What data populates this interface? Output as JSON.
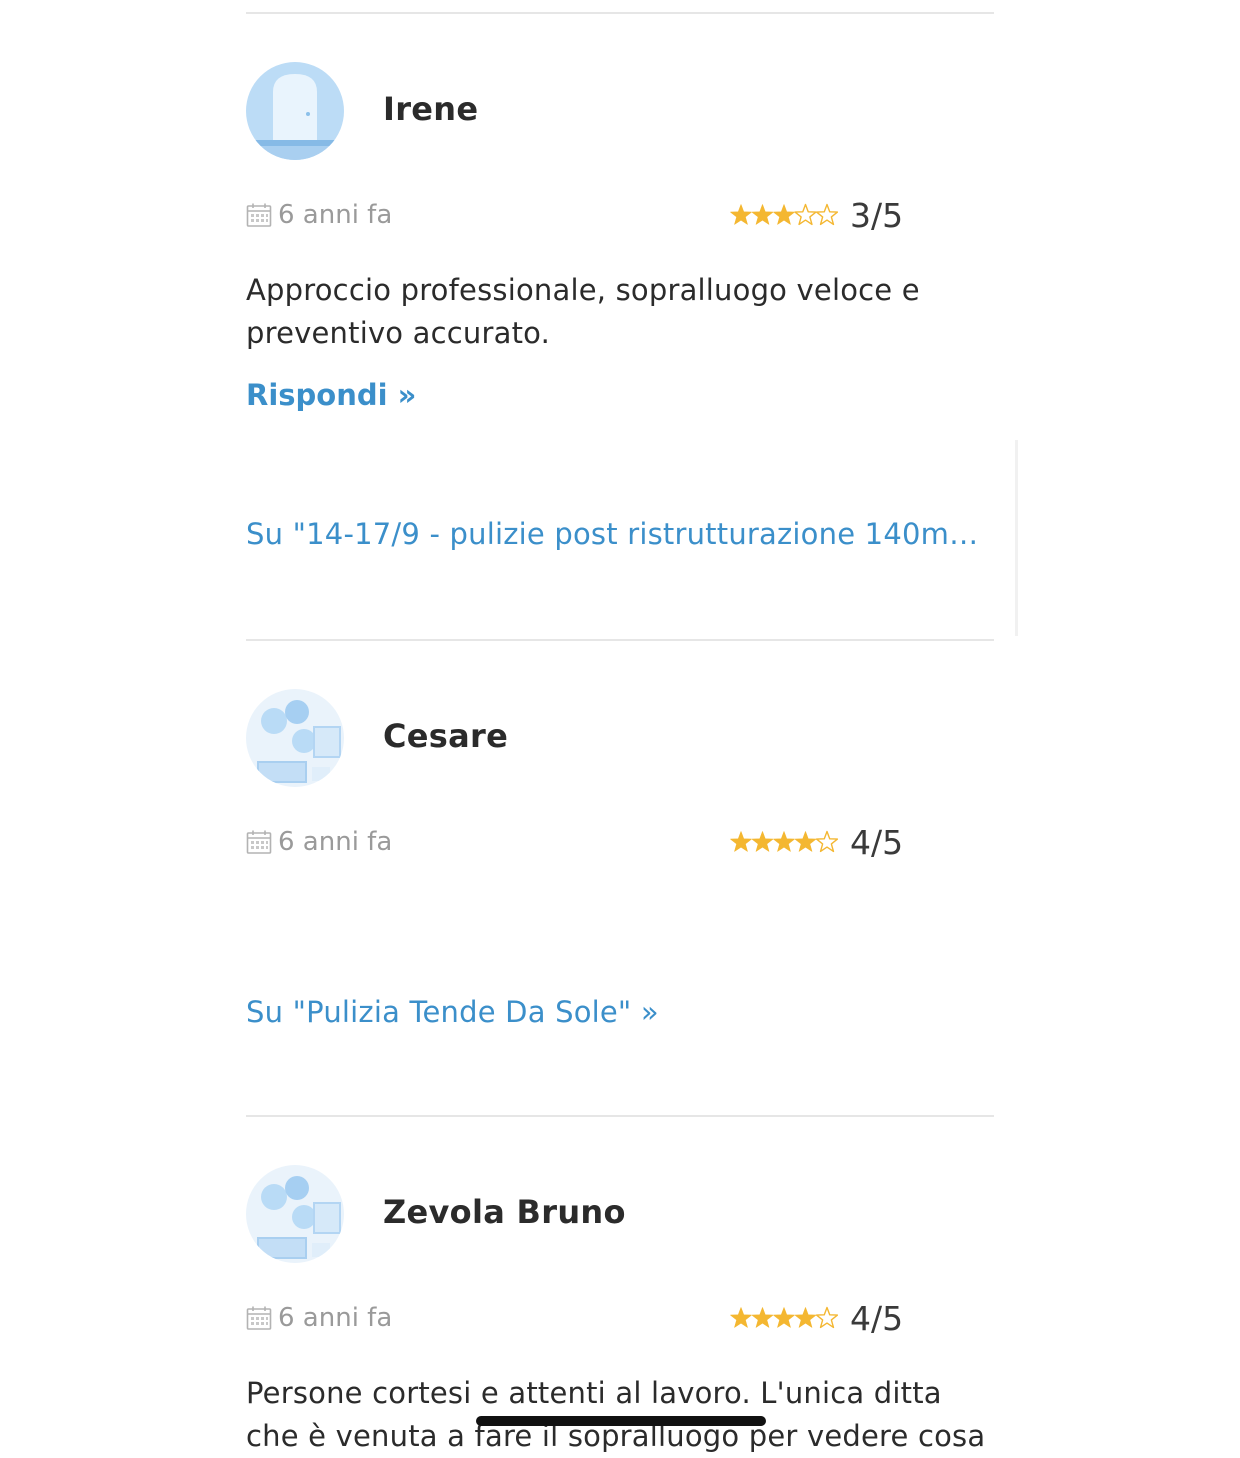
{
  "reviews": [
    {
      "name": "Irene",
      "avatar": "door-icon",
      "date": "6 anni fa",
      "stars": 3,
      "max_stars": 5,
      "score": "3/5",
      "text": "Approccio professionale, sopralluogo veloce e preventivo accurato.",
      "reply": "Rispondi »",
      "job": "Su \"14-17/9 - pulizie post ristrutturazione 140mq …"
    },
    {
      "name": "Cesare",
      "avatar": "living-room-icon",
      "date": "6 anni fa",
      "stars": 4,
      "max_stars": 5,
      "score": "4/5",
      "text": "",
      "job": "Su \"Pulizia Tende Da Sole\"  »"
    },
    {
      "name": "Zevola Bruno",
      "avatar": "living-room-icon",
      "date": "6 anni fa",
      "stars": 4,
      "max_stars": 5,
      "score": "4/5",
      "text": "Persone cortesi e attenti al lavoro. L'unica ditta che è venuta a fare il sopralluogo per vedere cosa"
    }
  ],
  "colors": {
    "accent": "#3b8fca",
    "star": "#f4b731",
    "muted": "#9a9a9a"
  }
}
